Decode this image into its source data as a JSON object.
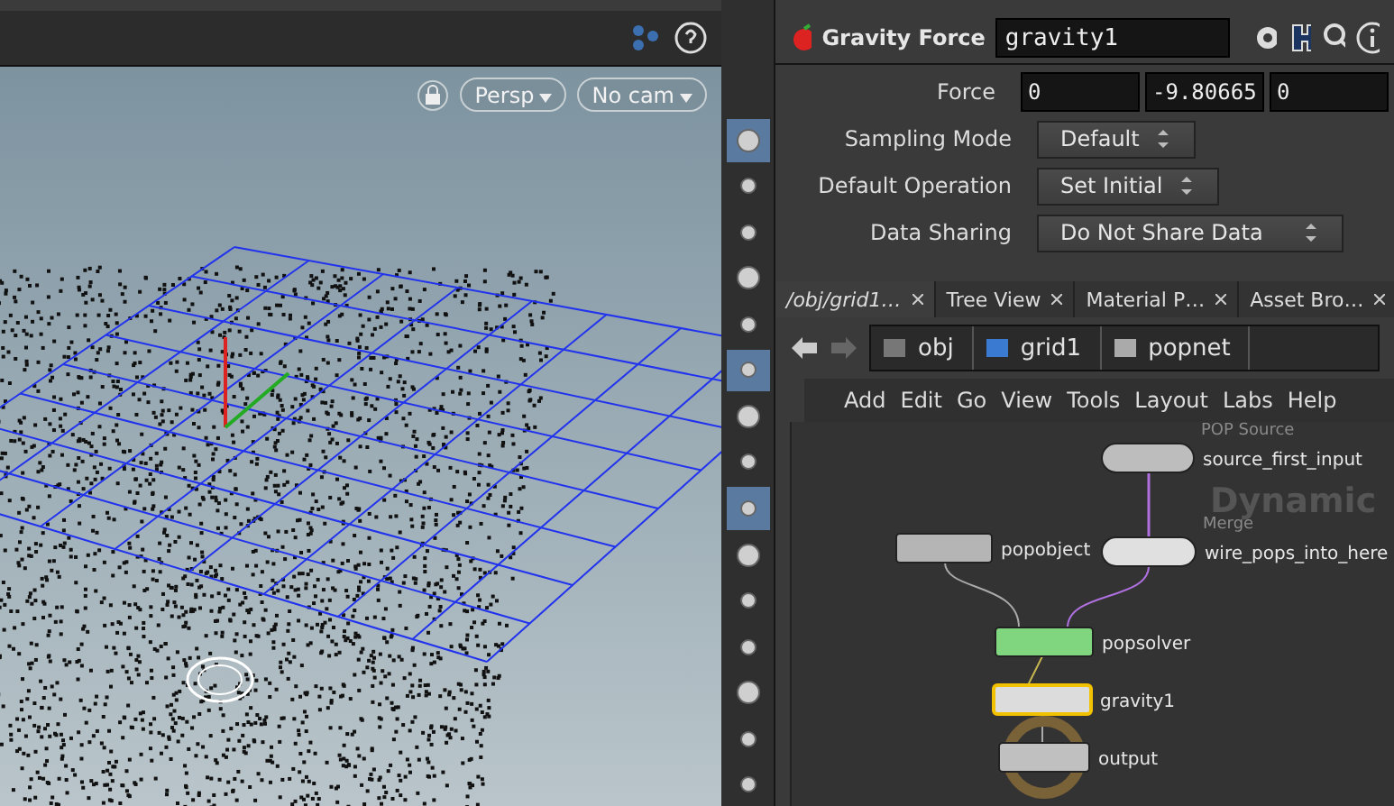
{
  "viewport": {
    "menus": [
      {
        "label": "Persp"
      },
      {
        "label": "No cam"
      }
    ],
    "tools": [
      {
        "selected": true
      },
      {
        "selected": false
      },
      {
        "selected": false
      },
      {
        "selected": false
      },
      {
        "selected": false
      },
      {
        "selected": true
      },
      {
        "selected": false
      },
      {
        "selected": false
      },
      {
        "selected": true
      },
      {
        "selected": false
      },
      {
        "selected": false
      },
      {
        "selected": false
      },
      {
        "selected": false
      },
      {
        "selected": false
      },
      {
        "selected": false
      }
    ]
  },
  "parameters": {
    "node_type": "Gravity Force",
    "node_name": "gravity1",
    "rows": [
      {
        "kind": "vector",
        "label": "Force",
        "values": [
          "0",
          "-9.80665",
          "0"
        ]
      },
      {
        "kind": "menu",
        "label": "Sampling Mode",
        "value": "Default"
      },
      {
        "kind": "menu",
        "label": "Default Operation",
        "value": "Set Initial"
      },
      {
        "kind": "menu",
        "label": "Data Sharing",
        "value": "Do Not Share Data"
      }
    ]
  },
  "tabs": [
    {
      "label": "/obj/grid1…",
      "selected": true
    },
    {
      "label": "Tree View",
      "selected": false
    },
    {
      "label": "Material P…",
      "selected": false
    },
    {
      "label": "Asset Bro…",
      "selected": false
    }
  ],
  "path": [
    {
      "label": "obj"
    },
    {
      "label": "grid1"
    },
    {
      "label": "popnet"
    }
  ],
  "menu": [
    "Add",
    "Edit",
    "Go",
    "View",
    "Tools",
    "Layout",
    "Labs",
    "Help"
  ],
  "network": {
    "label": "Dynamic",
    "nodes": [
      {
        "kind": "source",
        "type_label": "POP Source",
        "name": "source_first_input",
        "selected": false
      },
      {
        "kind": "object",
        "name": "popobject",
        "selected": false
      },
      {
        "kind": "merge",
        "type_label": "Merge",
        "name": "wire_pops_into_here",
        "selected": false
      },
      {
        "kind": "solver",
        "name": "popsolver",
        "selected": false
      },
      {
        "kind": "force",
        "name": "gravity1",
        "selected": true
      },
      {
        "kind": "output",
        "name": "output",
        "selected": false
      }
    ]
  }
}
